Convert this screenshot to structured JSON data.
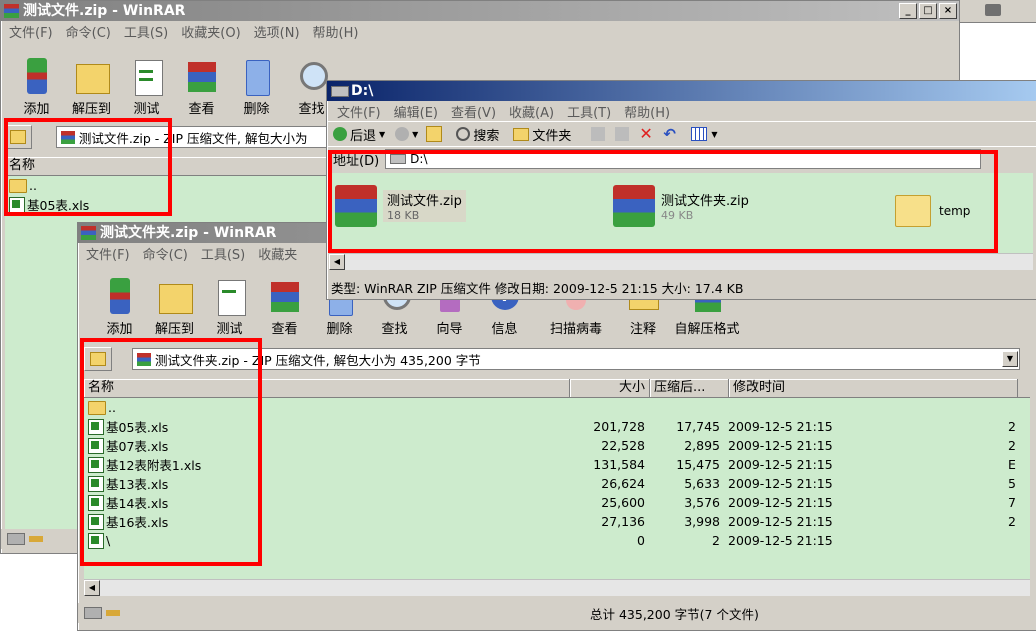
{
  "win1": {
    "title": "测试文件.zip - WinRAR",
    "menu": [
      "文件(F)",
      "命令(C)",
      "工具(S)",
      "收藏夹(O)",
      "选项(N)",
      "帮助(H)"
    ],
    "toolbar": [
      "添加",
      "解压到",
      "测试",
      "查看",
      "删除",
      "查找"
    ],
    "address": "测试文件.zip - ZIP 压缩文件, 解包大小为",
    "col_name": "名称",
    "rows": [
      {
        "name": ".."
      },
      {
        "name": "基05表.xls"
      }
    ]
  },
  "win2": {
    "title": "测试文件夹.zip - WinRAR",
    "menu": [
      "文件(F)",
      "命令(C)",
      "工具(S)",
      "收藏夹"
    ],
    "toolbar": [
      "添加",
      "解压到",
      "测试",
      "查看",
      "删除",
      "查找",
      "向导",
      "信息",
      "扫描病毒",
      "注释",
      "自解压格式"
    ],
    "address": "测试文件夹.zip - ZIP 压缩文件, 解包大小为 435,200 字节",
    "columns": [
      "名称",
      "大小",
      "压缩后...",
      "修改时间"
    ],
    "rows": [
      {
        "name": "..",
        "size": "",
        "packed": "",
        "modified": "",
        "extra": ""
      },
      {
        "name": "基05表.xls",
        "size": "201,728",
        "packed": "17,745",
        "modified": "2009-12-5 21:15",
        "extra": "2"
      },
      {
        "name": "基07表.xls",
        "size": "22,528",
        "packed": "2,895",
        "modified": "2009-12-5 21:15",
        "extra": "2"
      },
      {
        "name": "基12表附表1.xls",
        "size": "131,584",
        "packed": "15,475",
        "modified": "2009-12-5 21:15",
        "extra": "E"
      },
      {
        "name": "基13表.xls",
        "size": "26,624",
        "packed": "5,633",
        "modified": "2009-12-5 21:15",
        "extra": "5"
      },
      {
        "name": "基14表.xls",
        "size": "25,600",
        "packed": "3,576",
        "modified": "2009-12-5 21:15",
        "extra": "7"
      },
      {
        "name": "基16表.xls",
        "size": "27,136",
        "packed": "3,998",
        "modified": "2009-12-5 21:15",
        "extra": "2"
      },
      {
        "name": "\\",
        "size": "0",
        "packed": "2",
        "modified": "2009-12-5 21:15",
        "extra": ""
      }
    ],
    "status": "总计 435,200 字节(7 个文件)"
  },
  "explorer": {
    "title": "D:\\",
    "menu": [
      "文件(F)",
      "编辑(E)",
      "查看(V)",
      "收藏(A)",
      "工具(T)",
      "帮助(H)"
    ],
    "back": "后退",
    "search": "搜索",
    "folders": "文件夹",
    "address_label": "地址(D)",
    "address": "D:\\",
    "files": [
      {
        "name": "测试文件.zip",
        "size": "18 KB"
      },
      {
        "name": "测试文件夹.zip",
        "size": "49 KB"
      },
      {
        "name": "temp",
        "size": ""
      }
    ],
    "status": "类型: WinRAR ZIP 压缩文件 修改日期: 2009-12-5 21:15 大小: 17.4 KB"
  }
}
